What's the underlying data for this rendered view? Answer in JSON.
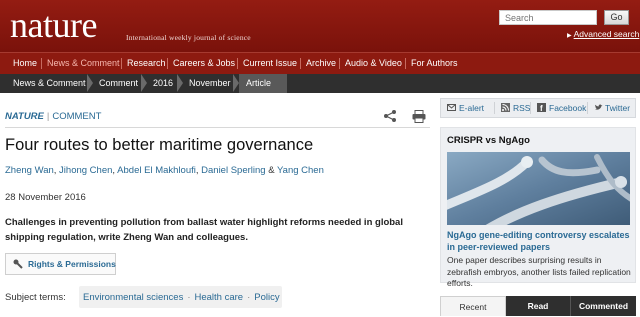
{
  "header": {
    "logo": "nature",
    "tagline": "International weekly journal of science",
    "search_placeholder": "Search",
    "search_button": "Go",
    "advanced_search": "Advanced search"
  },
  "nav": {
    "items": [
      "Home",
      "News & Comment",
      "Research",
      "Careers & Jobs",
      "Current Issue",
      "Archive",
      "Audio & Video",
      "For Authors"
    ],
    "active": "News & Comment"
  },
  "breadcrumb": [
    "News & Comment",
    "Comment",
    "2016",
    "November",
    "Article"
  ],
  "article": {
    "journal": "NATURE",
    "section": "COMMENT",
    "title": "Four routes to better maritime governance",
    "authors": [
      "Zheng Wan",
      "Jihong Chen",
      "Abdel El Makhloufi",
      "Daniel Sperling",
      "Yang Chen"
    ],
    "author_separator": ",",
    "author_and": "&",
    "date": "28 November 2016",
    "standfirst": "Challenges in preventing pollution from ballast water highlight reforms needed in global shipping regulation, write Zheng Wan and colleagues.",
    "rights_button": "Rights & Permissions",
    "subject_label": "Subject terms:",
    "subjects": [
      "Environmental sciences",
      "Health care",
      "Policy"
    ]
  },
  "rail": {
    "items": [
      "E-alert",
      "RSS",
      "Facebook",
      "Twitter"
    ]
  },
  "card": {
    "title": "CRISPR vs NgAgo",
    "link": "NgAgo gene-editing controversy escalates in peer-reviewed papers",
    "description": "One paper describes surprising results in zebrafish embryos, another lists failed replication efforts."
  },
  "tabs": [
    "Recent",
    "Read",
    "Commented"
  ],
  "colors": {
    "brand_red": "#8d1a10",
    "link_blue": "#2a6a94",
    "dark_bar": "#2f2f2f"
  }
}
